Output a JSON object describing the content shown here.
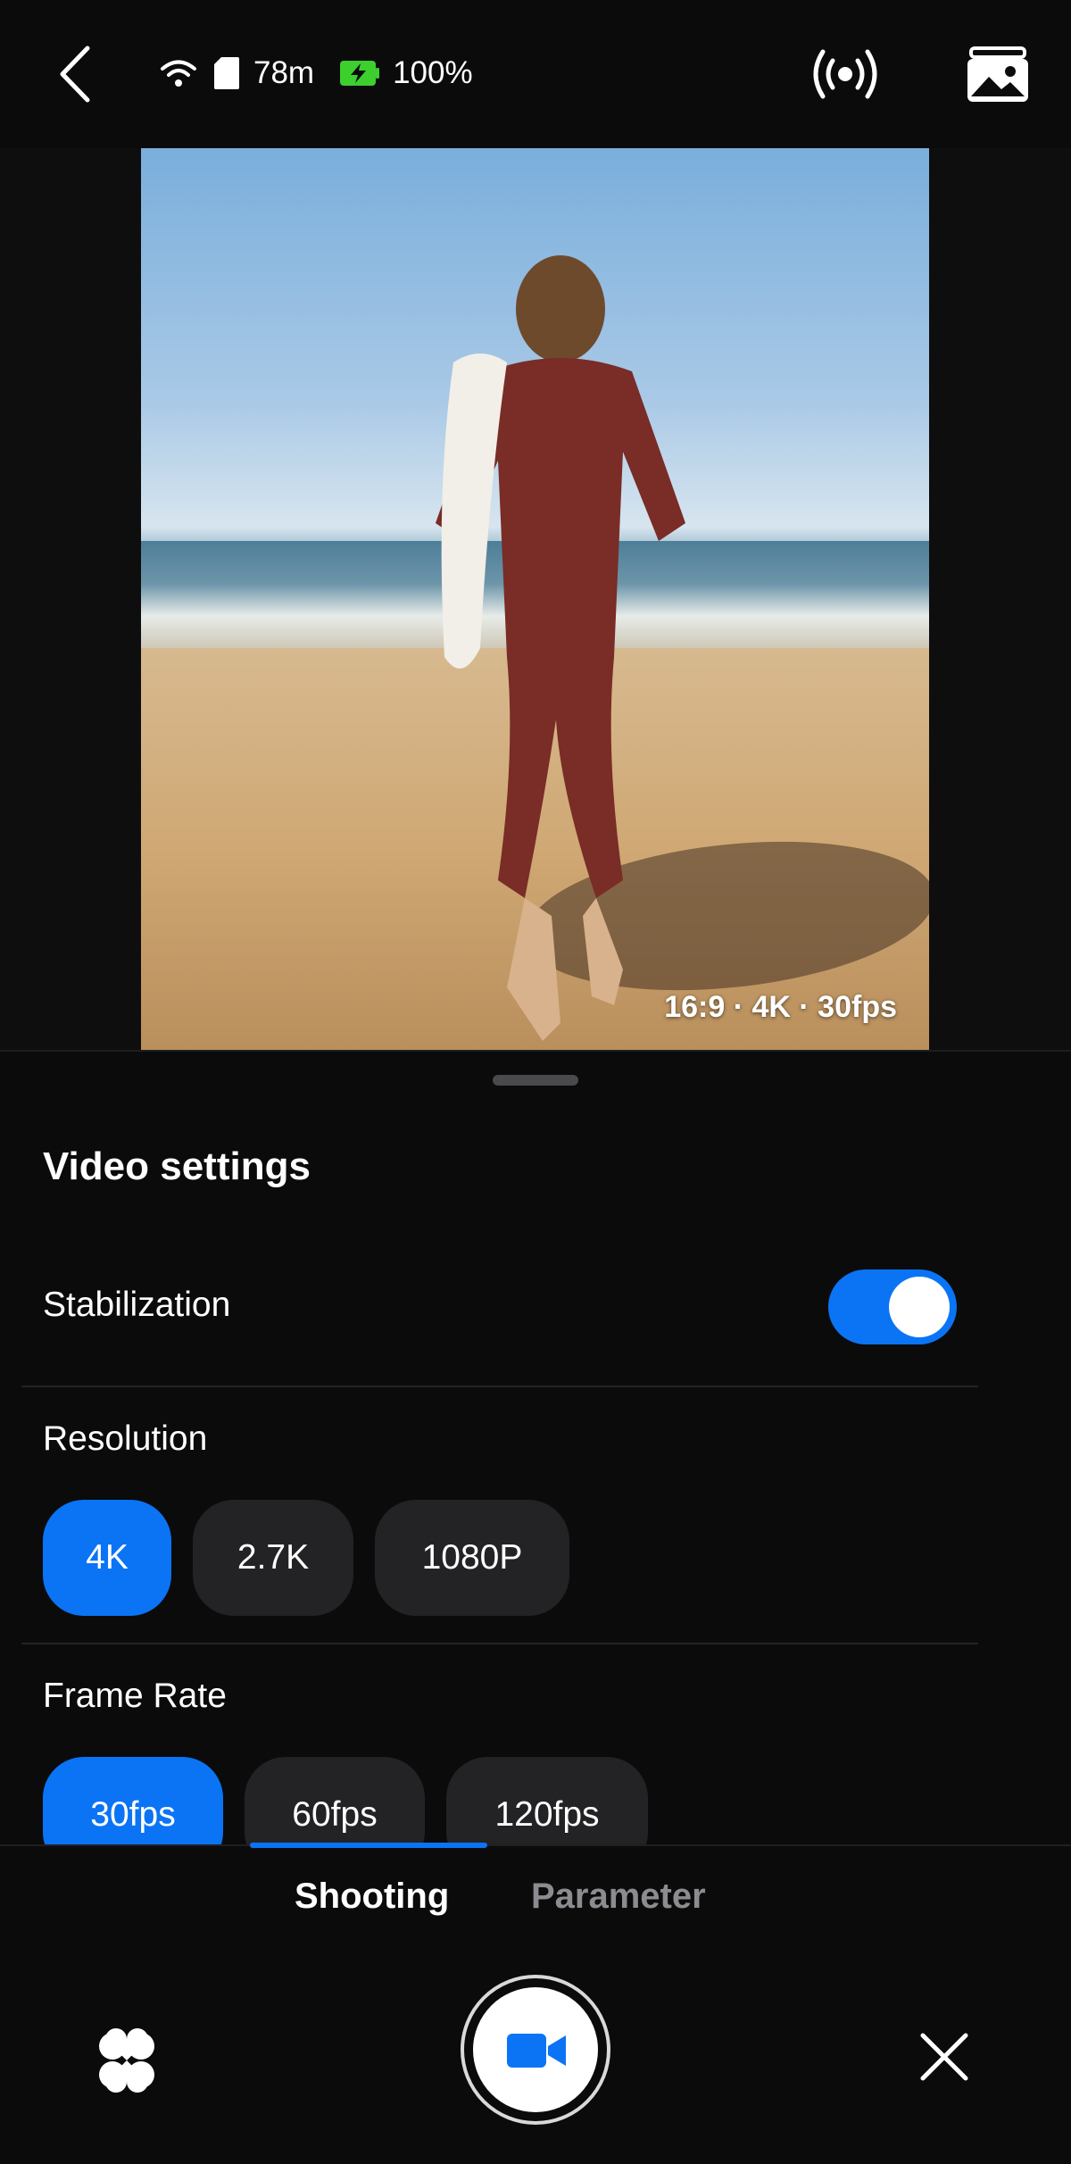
{
  "status_bar": {
    "storage_remaining": "78m",
    "battery_percent": "100%"
  },
  "preview": {
    "info_overlay": "16:9 · 4K · 30fps"
  },
  "video_settings": {
    "title": "Video settings",
    "stabilization": {
      "label": "Stabilization",
      "enabled": true
    },
    "resolution": {
      "label": "Resolution",
      "options": [
        "4K",
        "2.7K",
        "1080P"
      ],
      "selected": "4K"
    },
    "frame_rate": {
      "label": "Frame Rate",
      "options": [
        "30fps",
        "60fps",
        "120fps"
      ],
      "selected": "30fps"
    }
  },
  "tabs": {
    "items": [
      "Shooting",
      "Parameter"
    ],
    "active": "Shooting"
  },
  "colors": {
    "accent": "#0a74f5",
    "chip_inactive": "#232325",
    "background": "#0a0a0b",
    "battery": "#3ccf2e"
  }
}
